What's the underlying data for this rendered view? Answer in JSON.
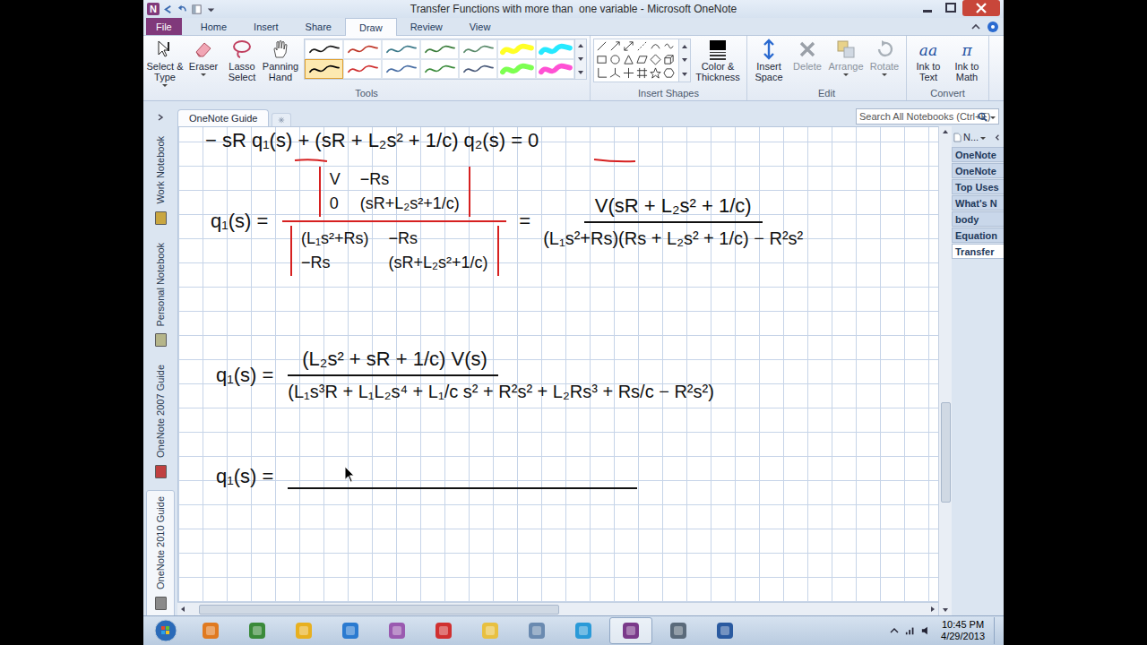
{
  "window": {
    "title": "Transfer Functions with more than  one variable - Microsoft OneNote",
    "app_logo": "N"
  },
  "ribbon": {
    "tabs": [
      {
        "label": "File",
        "kind": "file",
        "selected": false
      },
      {
        "label": "Home",
        "kind": "tab",
        "selected": false
      },
      {
        "label": "Insert",
        "kind": "tab",
        "selected": false
      },
      {
        "label": "Share",
        "kind": "tab",
        "selected": false
      },
      {
        "label": "Draw",
        "kind": "tab",
        "selected": true
      },
      {
        "label": "Review",
        "kind": "tab",
        "selected": false
      },
      {
        "label": "View",
        "kind": "tab",
        "selected": false
      }
    ],
    "tools": {
      "label": "Tools",
      "buttons": [
        {
          "label": "Select & Type",
          "disabled": false
        },
        {
          "label": "Eraser",
          "disabled": false
        },
        {
          "label": "Lasso Select",
          "disabled": false
        },
        {
          "label": "Panning Hand",
          "disabled": false
        }
      ],
      "pens": [
        {
          "kind": "pen",
          "color": "#1a1a1a",
          "selected": false
        },
        {
          "kind": "pen",
          "color": "#c0392b",
          "selected": false
        },
        {
          "kind": "pen",
          "color": "#3d7a8a",
          "selected": false
        },
        {
          "kind": "pen",
          "color": "#3b7d3b",
          "selected": false
        },
        {
          "kind": "pen",
          "color": "#5a8a6a",
          "selected": false
        },
        {
          "kind": "highlighter",
          "color": "#ffff00",
          "selected": false
        },
        {
          "kind": "highlighter",
          "color": "#00e5ff",
          "selected": false
        },
        {
          "kind": "pen",
          "color": "#000000",
          "selected": true
        },
        {
          "kind": "pen",
          "color": "#d03030",
          "selected": false
        },
        {
          "kind": "pen",
          "color": "#4a6fa5",
          "selected": false
        },
        {
          "kind": "pen",
          "color": "#3c8c3c",
          "selected": false
        },
        {
          "kind": "pen",
          "color": "#4a5a7a",
          "selected": false
        },
        {
          "kind": "highlighter",
          "color": "#66ff33",
          "selected": false
        },
        {
          "kind": "highlighter",
          "color": "#ff33cc",
          "selected": false
        }
      ]
    },
    "insert_shapes": {
      "label": "Insert Shapes",
      "buttons": [
        {
          "label": "Color & Thickness",
          "disabled": false
        }
      ]
    },
    "edit": {
      "label": "Edit",
      "buttons": [
        {
          "label": "Insert Space",
          "disabled": false
        },
        {
          "label": "Delete",
          "disabled": true
        },
        {
          "label": "Arrange",
          "disabled": true
        },
        {
          "label": "Rotate",
          "disabled": true
        }
      ]
    },
    "convert": {
      "label": "Convert",
      "buttons": [
        {
          "label": "Ink to Text",
          "glyph": "aa",
          "disabled": false
        },
        {
          "label": "Ink to Math",
          "glyph": "π",
          "disabled": false
        }
      ]
    }
  },
  "notebooks": [
    {
      "label": "Work Notebook",
      "color": "#c9a640",
      "selected": false
    },
    {
      "label": "Personal Notebook",
      "color": "#b5b58a",
      "selected": false
    },
    {
      "label": "OneNote 2007 Guide",
      "color": "#c04040",
      "selected": false
    },
    {
      "label": "OneNote 2010 Guide",
      "color": "#8a8a8a",
      "selected": true
    }
  ],
  "section_tabs": [
    {
      "label": "OneNote Guide",
      "selected": true
    }
  ],
  "search": {
    "placeholder": "Search All Notebooks (Ctrl+E)"
  },
  "page_tabs": {
    "header": "N...",
    "items": [
      {
        "label": "OneNote",
        "selected": false
      },
      {
        "label": "OneNote",
        "selected": false
      },
      {
        "label": "Top Uses",
        "selected": false
      },
      {
        "label": "What's N",
        "selected": false
      },
      {
        "label": "body",
        "selected": false
      },
      {
        "label": "Equation",
        "selected": false
      },
      {
        "label": "Transfer",
        "selected": true
      }
    ]
  },
  "page": {
    "line1": "− sR q₁(s) + (sR + L₂s² + 1/c) q₂(s) = 0",
    "det": {
      "label": "q₁(s) =",
      "numerator": [
        [
          "V",
          "−Rs"
        ],
        [
          "0",
          "(sR+L₂s²+1/c)"
        ]
      ],
      "denominator": [
        [
          "(L₁s²+Rs)",
          "−Rs"
        ],
        [
          "−Rs",
          "(sR+L₂s²+1/c)"
        ]
      ],
      "equals": "=",
      "result_numerator": "V(sR + L₂s² + 1/c)",
      "result_denominator": "(L₁s²+Rs)(Rs + L₂s² + 1/c) − R²s²"
    },
    "expanded": {
      "label": "q₁(s) =",
      "numerator": "(L₂s² + sR + 1/c) V(s)",
      "denominator": "(L₁s³R + L₁L₂s⁴ + L₁/c s² + R²s² + L₂Rs³ + Rs/c − R²s²)"
    },
    "final": {
      "label": "q₁(s) ="
    }
  },
  "taskbar": {
    "time": "10:45 PM",
    "date": "4/29/2013"
  }
}
